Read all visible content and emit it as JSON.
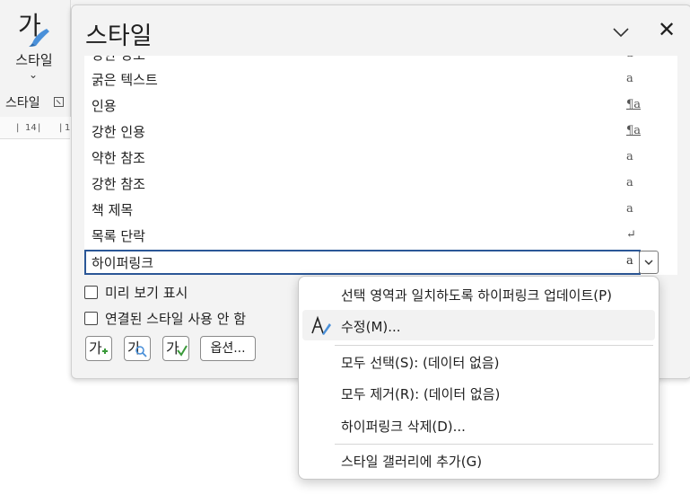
{
  "ribbon": {
    "styles_glyph": "가",
    "styles_label": "스타일",
    "group_label": "스타일",
    "ruler_marks": [
      "14",
      "1"
    ]
  },
  "pane": {
    "title": "스타일",
    "styles": [
      {
        "name": "강한 강조",
        "type": "a",
        "kind": "char"
      },
      {
        "name": "굵은 텍스트",
        "type": "a",
        "kind": "char"
      },
      {
        "name": "인용",
        "type": "¶a",
        "kind": "para"
      },
      {
        "name": "강한 인용",
        "type": "¶a",
        "kind": "para"
      },
      {
        "name": "약한 참조",
        "type": "a",
        "kind": "char"
      },
      {
        "name": "강한 참조",
        "type": "a",
        "kind": "char"
      },
      {
        "name": "책 제목",
        "type": "a",
        "kind": "char"
      },
      {
        "name": "목록 단락",
        "type": "↵",
        "kind": "para"
      },
      {
        "name": "하이퍼링크",
        "type": "a",
        "kind": "char",
        "selected": true
      }
    ],
    "show_preview_label": "미리 보기 표시",
    "disable_linked_label": "연결된 스타일 사용 안 함",
    "new_style_glyph": "가",
    "inspector_glyph": "가",
    "manage_glyph": "가",
    "options_label": "옵션..."
  },
  "context_menu": {
    "items": [
      {
        "label": "선택 영역과 일치하도록 하이퍼링크 업데이트(P)"
      },
      {
        "label": "수정(M)...",
        "icon": "modify-style-icon"
      },
      {
        "label": "모두 선택(S): (데이터 없음)"
      },
      {
        "label": "모두 제거(R): (데이터 없음)"
      },
      {
        "label": "하이퍼링크 삭제(D)..."
      },
      {
        "label": "스타일 갤러리에 추가(G)"
      }
    ]
  },
  "colors": {
    "accent": "#2b5797",
    "pane_bg": "#f3f3f3",
    "icon_blue": "#4a90d9",
    "icon_green": "#3a9a3a"
  }
}
